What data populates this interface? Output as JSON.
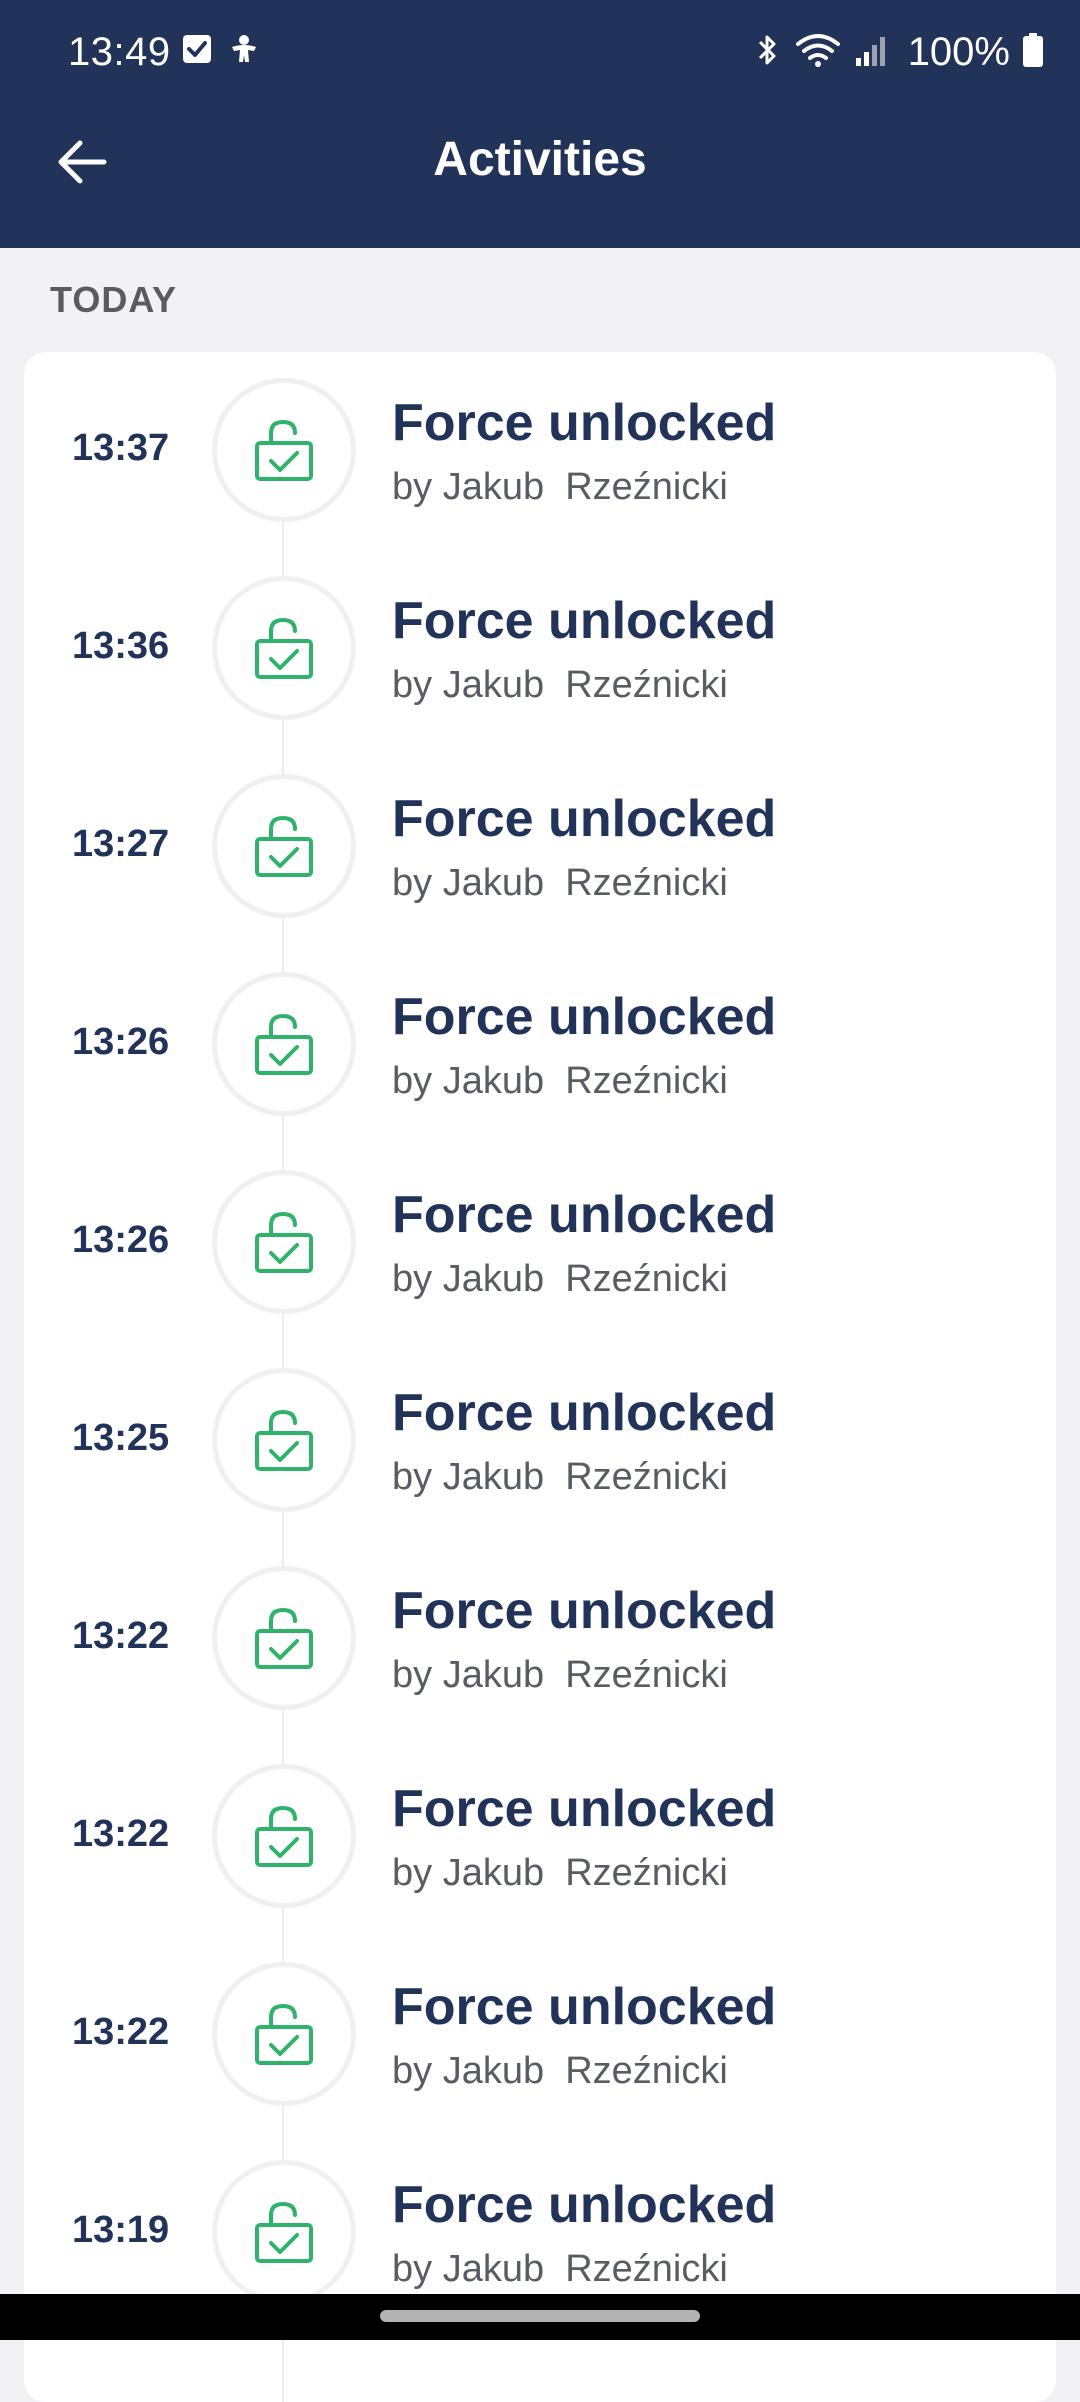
{
  "status_bar": {
    "time": "13:49",
    "battery": "100%",
    "left_icons": [
      "check-square-icon",
      "user-accessibility-icon"
    ],
    "right_icons": [
      "bluetooth-icon",
      "wifi-icon",
      "cellular-signal-icon",
      "battery-icon"
    ]
  },
  "header": {
    "title": "Activities",
    "back_icon": "arrow-left-icon"
  },
  "section": {
    "label": "TODAY"
  },
  "activities": [
    {
      "time": "13:37",
      "title": "Force unlocked",
      "subtitle": "by Jakub  Rzeźnicki",
      "icon": "unlocked-padlock-check-icon"
    },
    {
      "time": "13:36",
      "title": "Force unlocked",
      "subtitle": "by Jakub  Rzeźnicki",
      "icon": "unlocked-padlock-check-icon"
    },
    {
      "time": "13:27",
      "title": "Force unlocked",
      "subtitle": "by Jakub  Rzeźnicki",
      "icon": "unlocked-padlock-check-icon"
    },
    {
      "time": "13:26",
      "title": "Force unlocked",
      "subtitle": "by Jakub  Rzeźnicki",
      "icon": "unlocked-padlock-check-icon"
    },
    {
      "time": "13:26",
      "title": "Force unlocked",
      "subtitle": "by Jakub  Rzeźnicki",
      "icon": "unlocked-padlock-check-icon"
    },
    {
      "time": "13:25",
      "title": "Force unlocked",
      "subtitle": "by Jakub  Rzeźnicki",
      "icon": "unlocked-padlock-check-icon"
    },
    {
      "time": "13:22",
      "title": "Force unlocked",
      "subtitle": "by Jakub  Rzeźnicki",
      "icon": "unlocked-padlock-check-icon"
    },
    {
      "time": "13:22",
      "title": "Force unlocked",
      "subtitle": "by Jakub  Rzeźnicki",
      "icon": "unlocked-padlock-check-icon"
    },
    {
      "time": "13:22",
      "title": "Force unlocked",
      "subtitle": "by Jakub  Rzeźnicki",
      "icon": "unlocked-padlock-check-icon"
    },
    {
      "time": "13:19",
      "title": "Force unlocked",
      "subtitle": "by Jakub  Rzeźnicki",
      "icon": "unlocked-padlock-check-icon"
    }
  ],
  "colors": {
    "header_bg": "#22335a",
    "accent_green": "#2fb36a",
    "text_primary": "#22335a",
    "text_secondary": "#595c64",
    "page_bg": "#f1f1f6"
  }
}
